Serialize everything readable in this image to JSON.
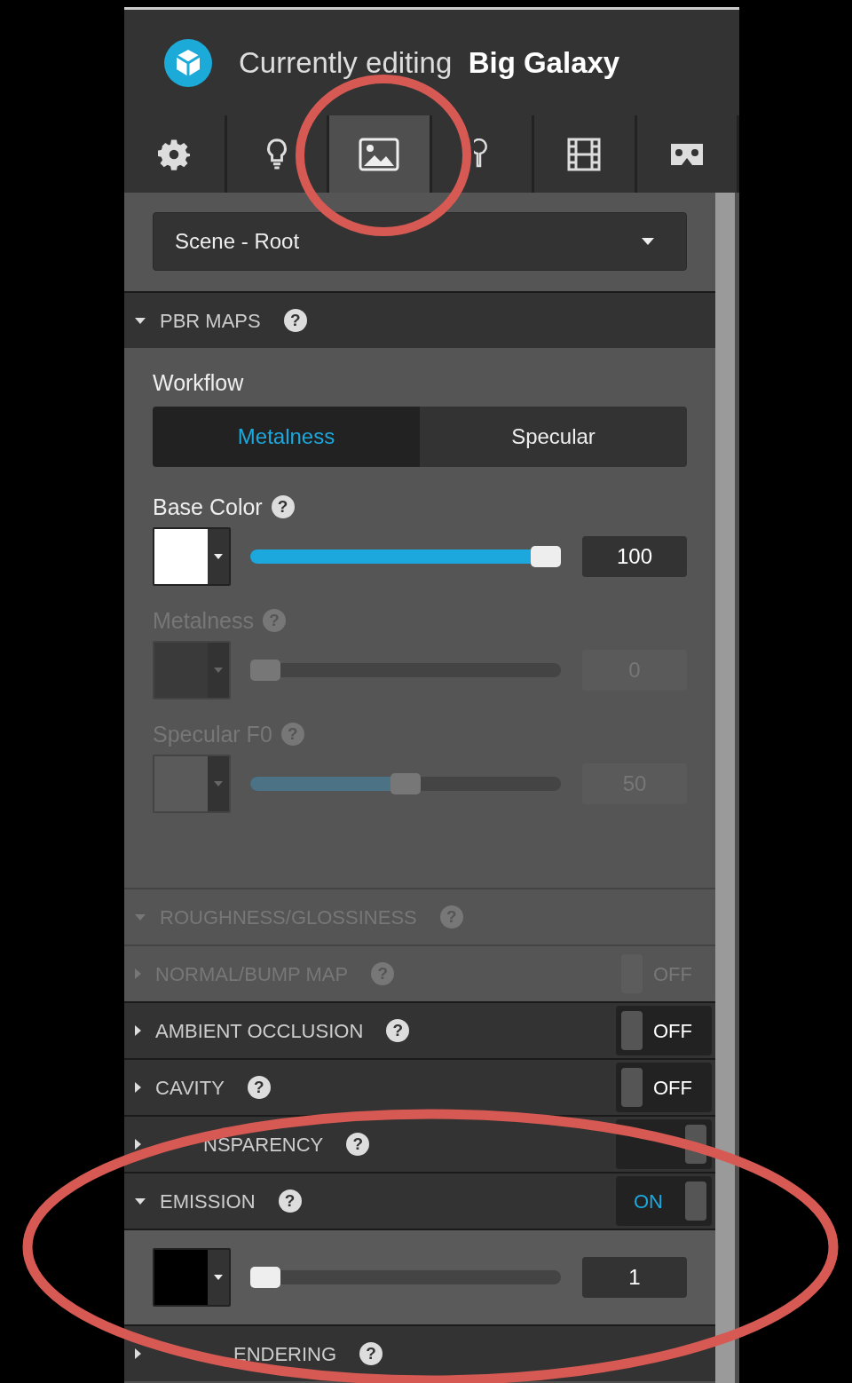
{
  "header": {
    "prefix": "Currently editing",
    "title": "Big Galaxy"
  },
  "tabs": [
    {
      "kind": "settings",
      "selected": false
    },
    {
      "kind": "light",
      "selected": false
    },
    {
      "kind": "image",
      "selected": true
    },
    {
      "kind": "pin",
      "selected": false
    },
    {
      "kind": "film",
      "selected": false
    },
    {
      "kind": "vr",
      "selected": false
    }
  ],
  "dropdown": {
    "value": "Scene - Root"
  },
  "sections": [
    {
      "title": "PBR MAPS",
      "help": "?",
      "expanded": true,
      "disabled": false,
      "workflow": {
        "label": "Workflow",
        "options": [
          {
            "label": "Metalness",
            "selected": true
          },
          {
            "label": "Specular",
            "selected": false
          }
        ]
      },
      "channels": [
        {
          "label": "Base Color",
          "help": "?",
          "disabled": false,
          "color": "#ffffff",
          "level": 1,
          "reading": "100"
        },
        {
          "label": "Metalness",
          "help": "?",
          "disabled": true,
          "color": "#3a3a3a",
          "level": 0,
          "reading": "0"
        },
        {
          "label": "Specular F0",
          "help": "?",
          "disabled": true,
          "color": "#5a5a5a",
          "level": 0.5,
          "reading": "50"
        }
      ]
    },
    {
      "title": "ROUGHNESS/GLOSSINESS",
      "help": "?",
      "expanded": true,
      "disabled": true
    },
    {
      "title": "NORMAL/BUMP MAP",
      "help": "?",
      "expanded": false,
      "disabled": true,
      "toggle": {
        "on": false,
        "label": "OFF"
      }
    },
    {
      "title": "AMBIENT OCCLUSION",
      "help": "?",
      "expanded": false,
      "disabled": false,
      "toggle": {
        "on": false,
        "label": "OFF"
      }
    },
    {
      "title": "CAVITY",
      "help": "?",
      "expanded": false,
      "disabled": false,
      "toggle": {
        "on": false,
        "label": "OFF"
      }
    },
    {
      "title": "NSPARENCY",
      "help": "?",
      "expanded": false,
      "disabled": false,
      "covered": true,
      "toggle": {
        "on": true
      }
    },
    {
      "title": "EMISSION",
      "help": "?",
      "expanded": true,
      "disabled": false,
      "toggle": {
        "on": true,
        "label": "ON"
      },
      "channels": [
        {
          "disabled": false,
          "color": "#000000",
          "level": 0.01,
          "reading": "1"
        }
      ]
    },
    {
      "title": "ENDERING",
      "help": "?",
      "expanded": false,
      "disabled": false,
      "covered": true
    }
  ]
}
